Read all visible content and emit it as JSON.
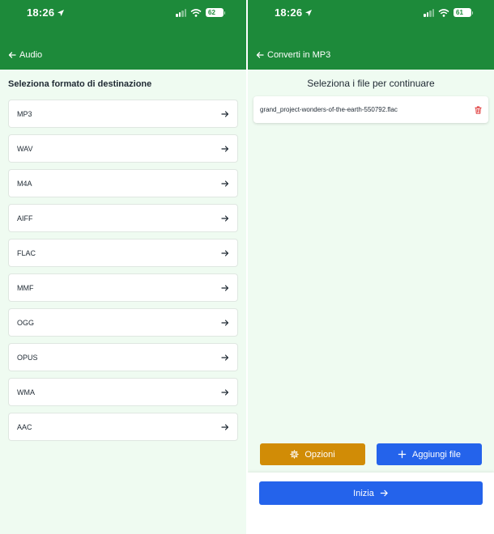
{
  "status_bar": {
    "time": "18:26",
    "left_battery": "62",
    "right_battery": "61"
  },
  "left_screen": {
    "nav_title": "Audio",
    "section_title": "Seleziona formato di destinazione",
    "formats": [
      {
        "label": "MP3"
      },
      {
        "label": "WAV"
      },
      {
        "label": "M4A"
      },
      {
        "label": "AIFF"
      },
      {
        "label": "FLAC"
      },
      {
        "label": "MMF"
      },
      {
        "label": "OGG"
      },
      {
        "label": "OPUS"
      },
      {
        "label": "WMA"
      },
      {
        "label": "AAC"
      }
    ]
  },
  "right_screen": {
    "nav_title": "Converti in MP3",
    "heading": "Seleziona i file per continuare",
    "files": [
      {
        "name": "grand_project-wonders-of-the-earth-550792.flac"
      }
    ],
    "options_button": "Opzioni",
    "add_files_button": "Aggiungi file",
    "start_button": "Inizia"
  },
  "colors": {
    "header_green": "#1d8a3a",
    "background_mint": "#effbf1",
    "options_orange": "#d18c06",
    "primary_blue": "#2463eb",
    "delete_red": "#dc2626"
  }
}
